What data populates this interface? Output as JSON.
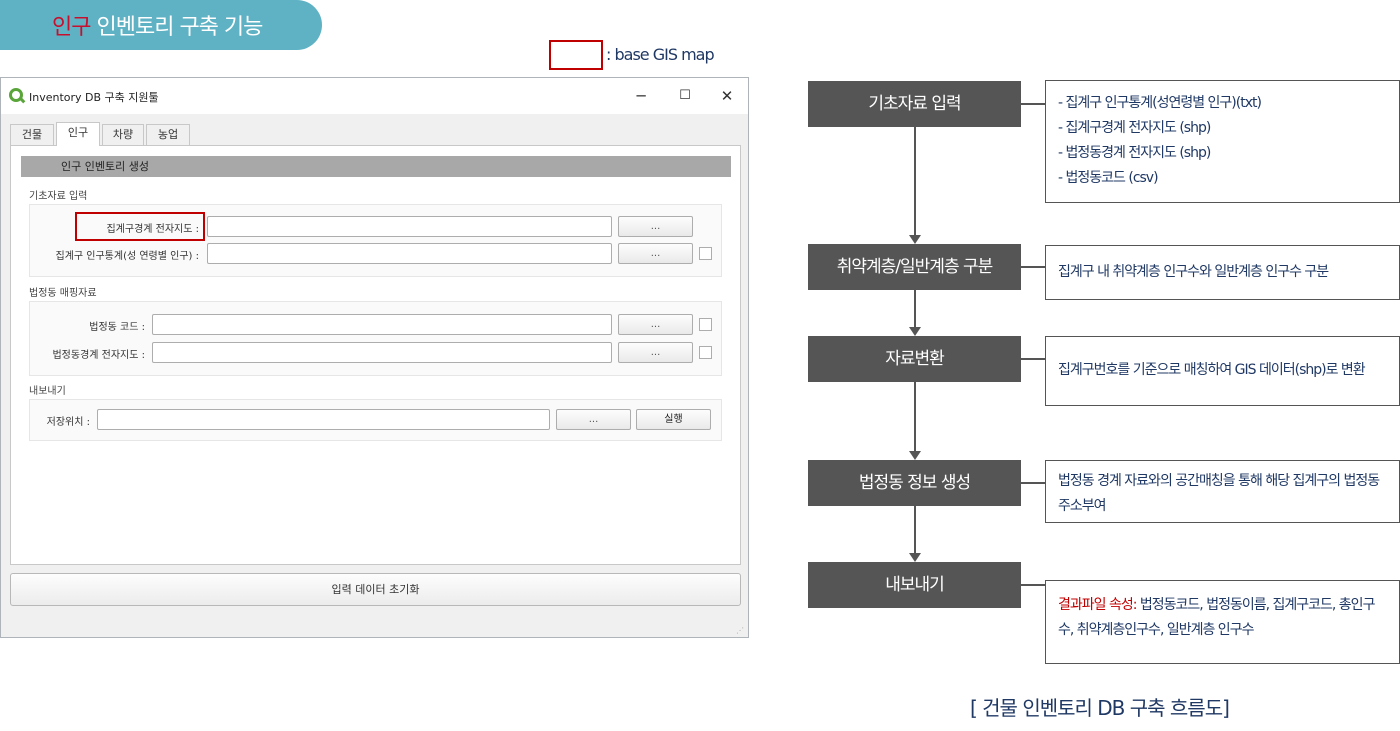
{
  "header": {
    "title_red": "인구",
    "title_rest": "인벤토리 구축 기능"
  },
  "legend": {
    "text": ": base GIS map"
  },
  "window": {
    "title": "Inventory DB 구축 지원툴",
    "controls": {
      "minimize": "─",
      "maximize": "☐",
      "close": "✕"
    },
    "tabs": [
      "건물",
      "인구",
      "차량",
      "농업"
    ],
    "section_title": "인구 인벤토리 생성",
    "group1": {
      "label": "기초자료 입력",
      "row1_label": "집계구경계 전자지도 :",
      "row2_label": "집계구 인구통계(성 연령별 인구) :"
    },
    "group2": {
      "label": "법정동 매핑자료",
      "row1_label": "법정동 코드 :",
      "row2_label": "법정동경계 전자지도 :"
    },
    "group3": {
      "label": "내보내기",
      "row1_label": "저장위치 :",
      "run": "실행"
    },
    "browse": "...",
    "reset": "입력 데이터 초기화"
  },
  "flow": {
    "steps": [
      "기초자료 입력",
      "취약계층/일반계층 구분",
      "자료변환",
      "법정동 정보 생성",
      "내보내기"
    ],
    "box1": [
      "- 집계구 인구통계(성연령별 인구)(txt)",
      "- 집계구경계 전자지도 (shp)",
      "- 법정동경계 전자지도 (shp)",
      "- 법정동코드 (csv)"
    ],
    "box2": "집계구 내 취약계층 인구수와 일반계층 인구수 구분",
    "box3": "집계구번호를 기준으로 매칭하여 GIS 데이터(shp)로 변환",
    "box4": "법정동 경계 자료와의 공간매칭을 통해 해당 집계구의 법정동 주소부여",
    "box5_red": "결과파일 속성:",
    "box5_rest": " 법정동코드, 법정동이름, 집계구코드, 총인구수, 취약계층인구수, 일반계층 인구수"
  },
  "caption": "[ 건물 인벤토리 DB 구축 흐름도]",
  "colors": {
    "pill": "#5fb2c4",
    "accent_red": "#c00000",
    "node": "#555555",
    "text_navy": "#1f3864"
  }
}
